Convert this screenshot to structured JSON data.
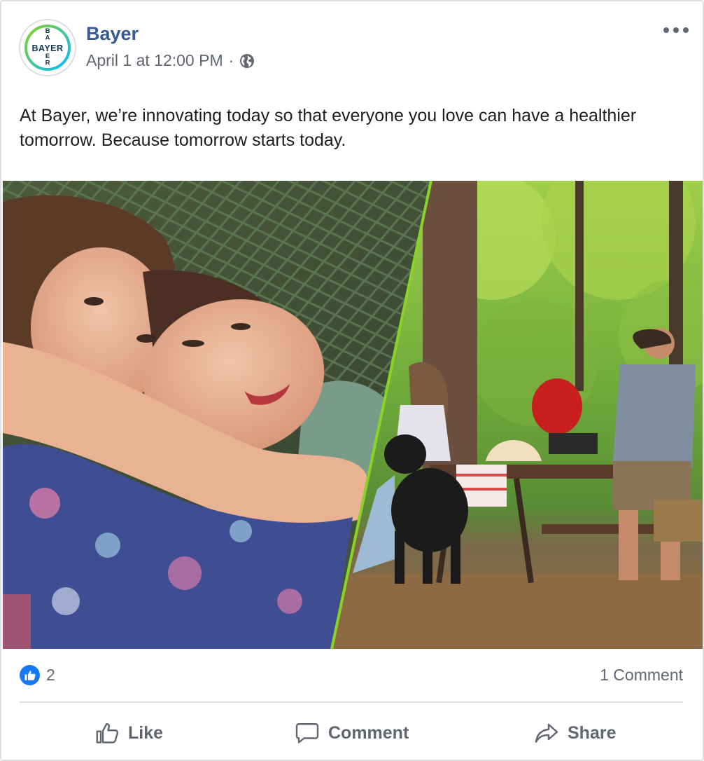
{
  "post": {
    "page_name": "Bayer",
    "timestamp": "April 1 at 12:00 PM",
    "separator": "·",
    "privacy_icon": "globe-icon",
    "more_icon": "ellipsis-icon",
    "text": "At Bayer, we’re innovating today so that everyone you love can have a healthier tomorrow. Because tomorrow starts today.",
    "logo_text_horizontal": "BAYER",
    "logo_text_vertical": "BAYER",
    "image_description_icon": "photo"
  },
  "reactions": {
    "like_icon": "thumbs-up-icon",
    "count": "2",
    "comments": "1 Comment"
  },
  "actions": {
    "like": "Like",
    "comment": "Comment",
    "share": "Share"
  },
  "colors": {
    "brand_link": "#385898",
    "like_blue": "#1877f2",
    "bayer_green": "#89d329",
    "bayer_blue": "#10384f",
    "muted_text": "#606770"
  }
}
